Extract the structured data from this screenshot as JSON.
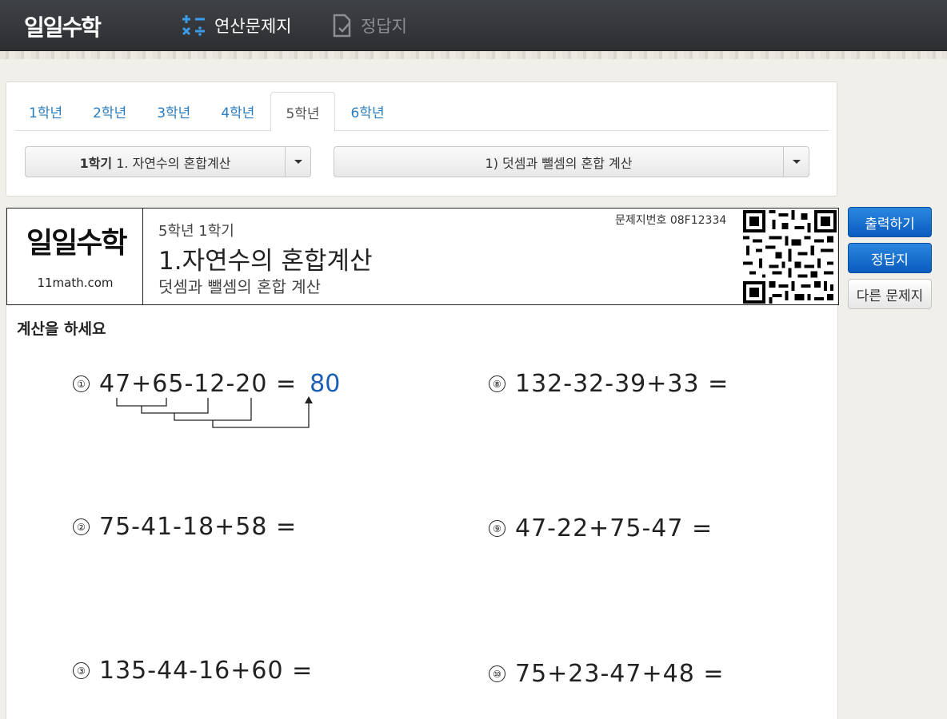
{
  "topbar": {
    "logo": "일일수학",
    "nav": [
      {
        "label": "연산문제지",
        "icon": "calc-icon",
        "active": true
      },
      {
        "label": "정답지",
        "icon": "answer-sheet-icon",
        "active": false
      }
    ]
  },
  "grade_tabs": [
    "1학년",
    "2학년",
    "3학년",
    "4학년",
    "5학년",
    "6학년"
  ],
  "active_tab": "5학년",
  "semester_select": {
    "bold": "1학기",
    "text": "1. 자연수의 혼합계산"
  },
  "topic_select": {
    "text": "1) 덧셈과 뺄셈의 혼합 계산"
  },
  "sheet": {
    "logo": "일일수학",
    "site": "11math.com",
    "grade": "5학년 1학기",
    "title": "1.자연수의 혼합계산",
    "subtitle": "덧셈과 뺄셈의 혼합 계산",
    "code": "문제지번호 08F12334",
    "instruction": "계산을 하세요",
    "problems": [
      {
        "n": "①",
        "expr": "47+65-12-20 =",
        "answer": "80"
      },
      {
        "n": "②",
        "expr": "75-41-18+58 =",
        "answer": ""
      },
      {
        "n": "③",
        "expr": "135-44-16+60 =",
        "answer": ""
      },
      {
        "n": "⑧",
        "expr": "132-32-39+33 =",
        "answer": ""
      },
      {
        "n": "⑨",
        "expr": "47-22+75-47 =",
        "answer": ""
      },
      {
        "n": "⑩",
        "expr": "75+23-47+48 =",
        "answer": ""
      }
    ]
  },
  "buttons": {
    "print": "출력하기",
    "answers": "정답지",
    "other": "다른 문제지"
  },
  "colors": {
    "link": "#2a7dc1",
    "answer": "#1a5fb4",
    "primary": "#0a5bbd"
  }
}
